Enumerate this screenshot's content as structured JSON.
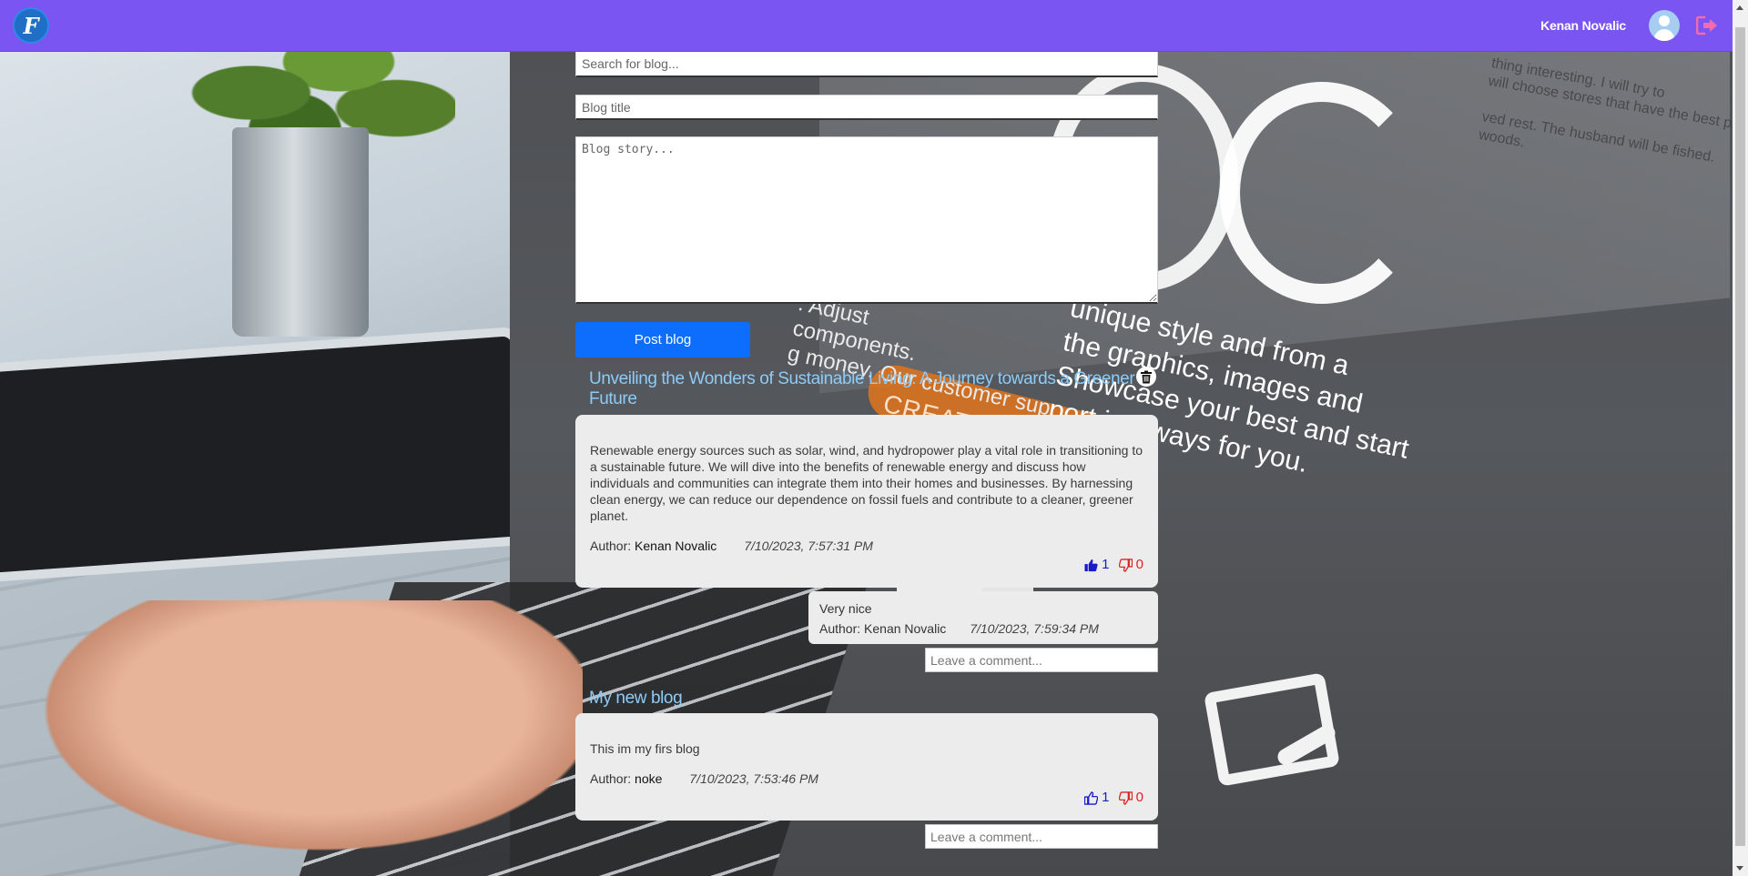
{
  "header": {
    "logo_glyph": "F",
    "username": "Kenan Novalic",
    "avatar_icon": "user-avatar-icon",
    "logout_icon": "logout-icon",
    "accent_color": "#7b55f2"
  },
  "background_text": {
    "lines": "unique style and from a\nthe graphics, images and\nShowcase your best and start\nport is always for you.",
    "side_lines": ". Adjust\ncomponents.\ng money. Our customer sup",
    "orange_button": "CREATE YOU",
    "screen_text": "thing interesting. I will try to\nwill choose stores that have the best price\n\nved rest. The husband will be fished.\nwoods."
  },
  "form": {
    "search_placeholder": "Search for blog...",
    "title_placeholder": "Blog title",
    "story_placeholder": "Blog story...",
    "post_button": "Post blog"
  },
  "posts": [
    {
      "title": "Unveiling the Wonders of Sustainable Living: A Journey towards a Greener Future",
      "story": "Renewable energy sources such as solar, wind, and hydropower play a vital role in transitioning to a sustainable future. We will dive into the benefits of renewable energy and discuss how individuals and communities can integrate them into their homes and businesses. By harnessing clean energy, we can reduce our dependence on fossil fuels and contribute to a cleaner, greener planet.",
      "author_label": "Author:",
      "author": "Kenan Novalic",
      "date": "7/10/2023, 7:57:31 PM",
      "likes": "1",
      "dislikes": "0",
      "liked": true,
      "deletable": true,
      "comments": [
        {
          "text": "Very nice",
          "author_label": "Author:",
          "author": "Kenan Novalic",
          "date": "7/10/2023, 7:59:34 PM"
        }
      ],
      "comment_placeholder": "Leave a comment..."
    },
    {
      "title": "My new blog",
      "story": "This im my firs blog",
      "author_label": "Author:",
      "author": "noke",
      "date": "7/10/2023, 7:53:46 PM",
      "likes": "1",
      "dislikes": "0",
      "liked": false,
      "deletable": false,
      "comments": [],
      "comment_placeholder": "Leave a comment..."
    }
  ]
}
